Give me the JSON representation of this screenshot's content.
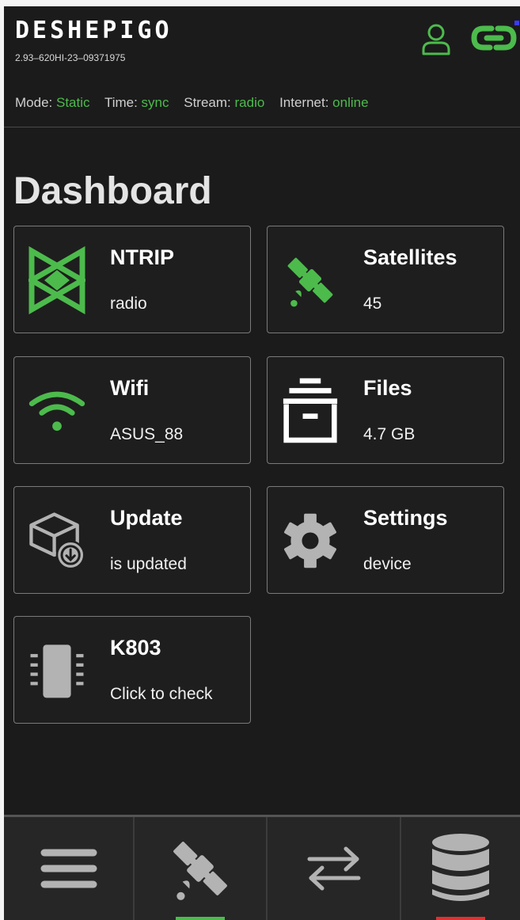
{
  "header": {
    "brand": "DESHEPIGO",
    "serial": "2.93–620HI-23–09371975",
    "status": [
      {
        "label": "Mode:",
        "value": "Static"
      },
      {
        "label": "Time:",
        "value": "sync"
      },
      {
        "label": "Stream:",
        "value": "radio"
      },
      {
        "label": "Internet:",
        "value": "online"
      }
    ],
    "icons": {
      "user": "user-icon",
      "link": "link-icon"
    }
  },
  "page_title": "Dashboard",
  "cards": [
    {
      "title": "NTRIP",
      "subtitle": "radio",
      "icon": "ntrip-icon"
    },
    {
      "title": "Satellites",
      "subtitle": "45",
      "icon": "satellite-icon"
    },
    {
      "title": "Wifi",
      "subtitle": "ASUS_88",
      "icon": "wifi-icon"
    },
    {
      "title": "Files",
      "subtitle": "4.7 GB",
      "icon": "archive-icon"
    },
    {
      "title": "Update",
      "subtitle": "is updated",
      "icon": "update-box-icon"
    },
    {
      "title": "Settings",
      "subtitle": "device",
      "icon": "gear-icon"
    },
    {
      "title": "K803",
      "subtitle": "Click to check",
      "icon": "chip-icon"
    }
  ],
  "bottom_nav": [
    {
      "icon": "menu-icon",
      "active": false
    },
    {
      "icon": "satellite-icon",
      "active": true
    },
    {
      "icon": "transfer-arrows-icon",
      "active": false
    },
    {
      "icon": "database-icon",
      "active": false
    }
  ],
  "colors": {
    "accent_green": "#4cbb4c",
    "background": "#1b1b1b",
    "card_border": "#7a7a7a",
    "icon_gray": "#b3b3b3",
    "active_indicator": "#4cbb4c",
    "alert_indicator": "#e03030"
  }
}
